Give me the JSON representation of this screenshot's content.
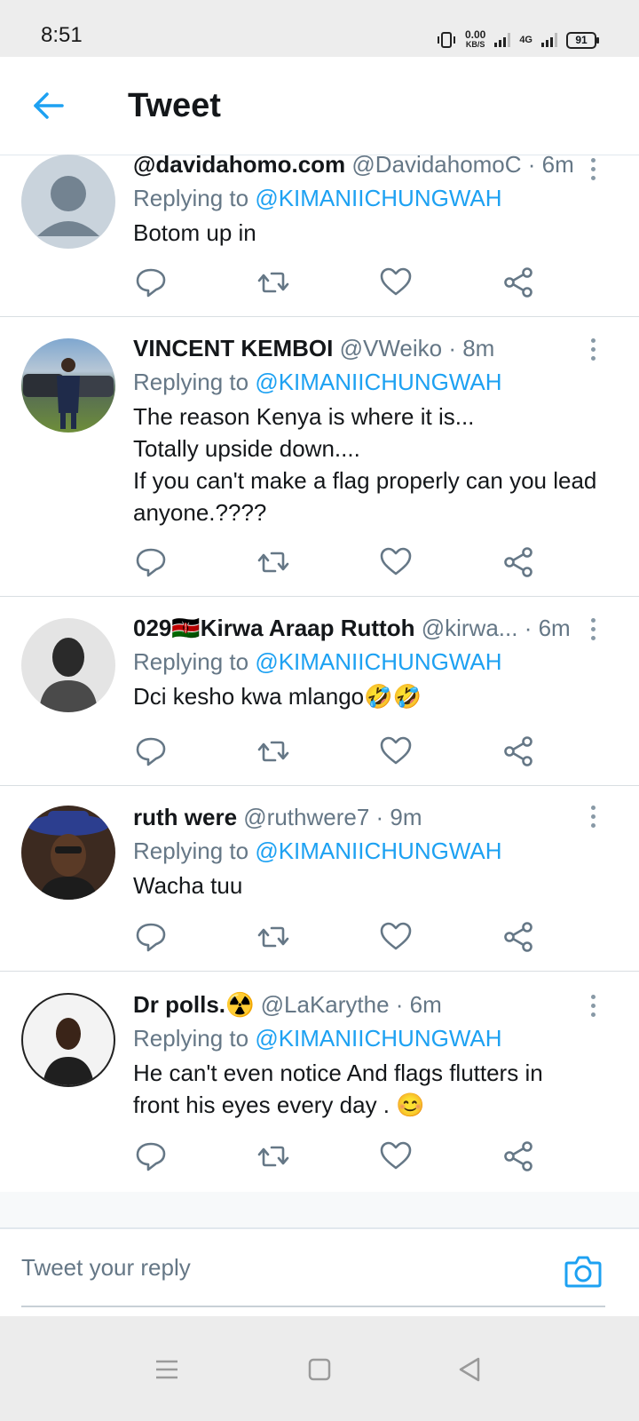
{
  "status_bar": {
    "time": "8:51",
    "net_speed_value": "0.00",
    "net_speed_unit": "KB/S",
    "network_type": "4G",
    "battery": "91"
  },
  "header": {
    "title": "Tweet",
    "back_icon": "arrow-left-icon",
    "accent_color": "#1da1f2"
  },
  "tweets": [
    {
      "name": "@davidahomo.com",
      "handle": "@DavidahomoC",
      "time": "· 6m",
      "replying_prefix": "Replying to",
      "mention": "@KIMANIICHUNGWAH",
      "text_lines": [
        "Botom up in"
      ]
    },
    {
      "name": "VINCENT KEMBOI",
      "handle": "@VWeiko",
      "time": "· 8m",
      "replying_prefix": "Replying to",
      "mention": "@KIMANIICHUNGWAH",
      "text_lines": [
        "The reason Kenya is where it is...",
        "Totally upside down....",
        "If you can't make a flag properly can you lead",
        "anyone.????"
      ]
    },
    {
      "name": "029🇰🇪Kirwa Araap Ruttoh",
      "handle": "@kirwa...",
      "time": "· 6m",
      "replying_prefix": "Replying to",
      "mention": "@KIMANIICHUNGWAH",
      "text_lines": [
        "Dci kesho kwa mlango🤣🤣"
      ]
    },
    {
      "name": "ruth were",
      "handle": "@ruthwere7",
      "time": "· 9m",
      "replying_prefix": "Replying to",
      "mention": "@KIMANIICHUNGWAH",
      "text_lines": [
        "Wacha tuu"
      ]
    },
    {
      "name": "Dr polls.☢️",
      "handle": "@LaKarythe",
      "time": "· 6m",
      "replying_prefix": "Replying to",
      "mention": "@KIMANIICHUNGWAH",
      "text_lines": [
        "He can't even notice And  flags flutters in",
        "front his eyes every day . 😊"
      ]
    }
  ],
  "reply_bar": {
    "placeholder": "Tweet your reply",
    "camera_icon": "camera-icon"
  },
  "nav_bar": {
    "icons": [
      "menu-icon",
      "home-square-icon",
      "back-triangle-icon"
    ]
  }
}
